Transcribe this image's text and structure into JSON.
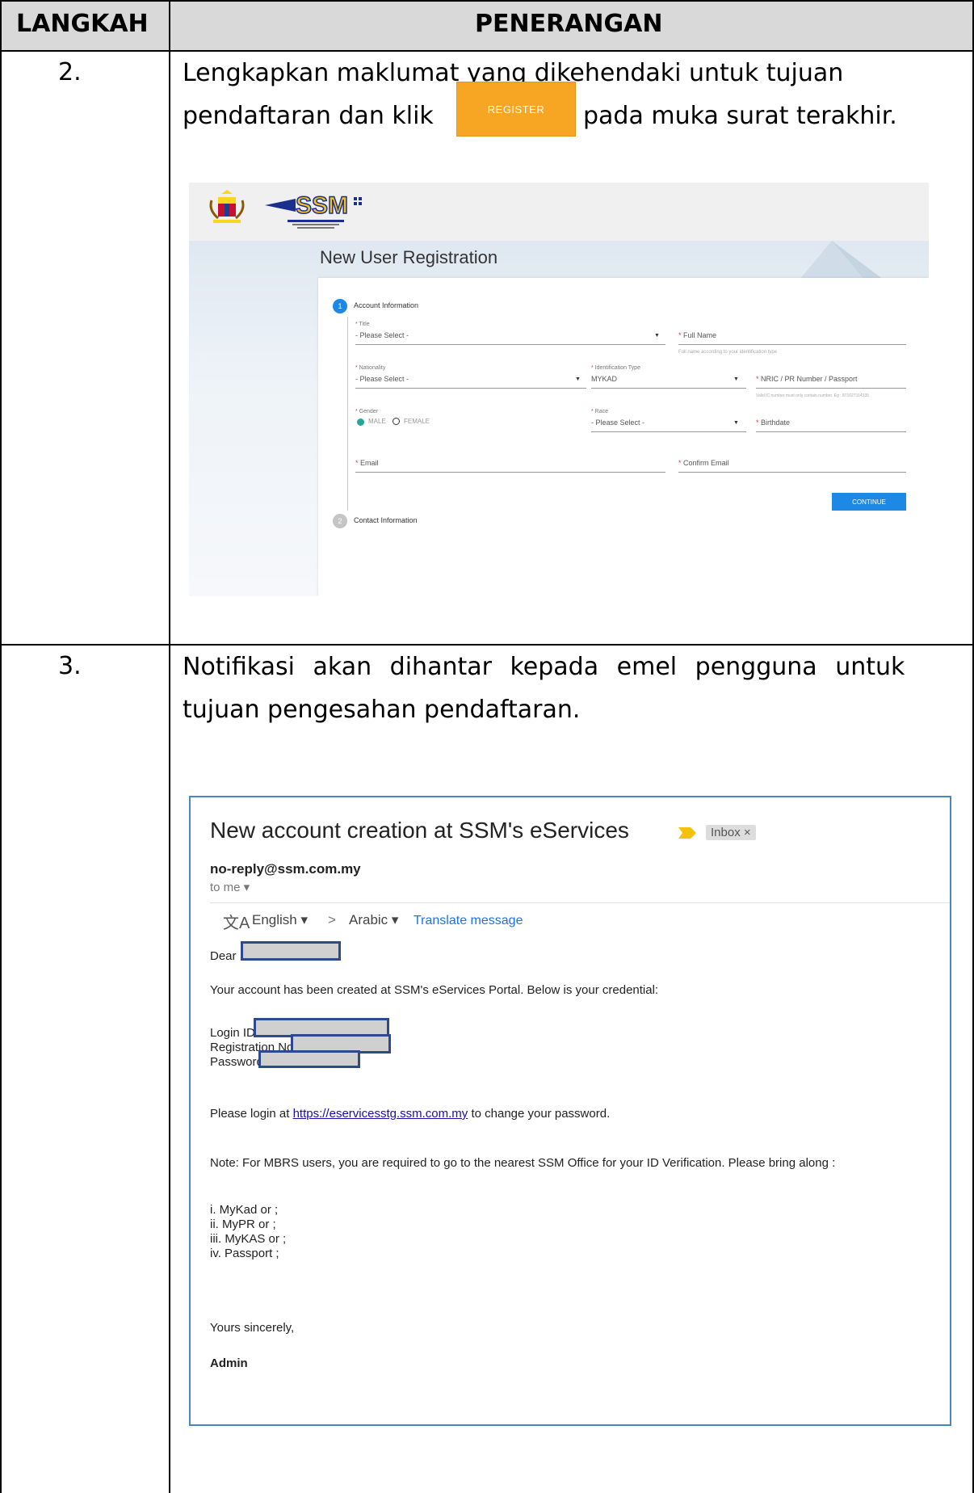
{
  "table": {
    "header_step": "LANGKAH",
    "header_desc": "PENERANGAN"
  },
  "rows": [
    {
      "step": "2.",
      "desc_line1": "Lengkapkan maklumat yang dikehendaki untuk tujuan",
      "desc_line2a": "pendaftaran dan klik",
      "button_label": "REGISTER",
      "desc_line2b": "pada muka surat terakhir."
    },
    {
      "step": "3.",
      "desc_line1": "Notifikasi akan dihantar kepada emel pengguna untuk",
      "desc_line2": "tujuan pengesahan pendaftaran."
    }
  ],
  "registration_form": {
    "title": "New User Registration",
    "step1_label": "Account Information",
    "step1_number": "1",
    "step2_label": "Contact Information",
    "step2_number": "2",
    "fields": {
      "title_label": "Title",
      "title_value": "- Please Select -",
      "fullname_label": "Full Name",
      "fullname_hint": "Full name according to your identification type",
      "nationality_label": "Nationality",
      "nationality_value": "- Please Select -",
      "idtype_label": "Identification Type",
      "idtype_value": "MYKAD",
      "nric_label": "NRIC / PR Number / Passport",
      "nric_hint": "Valid IC number must only contain number. Eg : 871027114335",
      "gender_label": "Gender",
      "gender_male": "MALE",
      "gender_female": "FEMALE",
      "race_label": "Race",
      "race_value": "- Please Select -",
      "birthdate_label": "Birthdate",
      "email_label": "Email",
      "confirm_email_label": "Confirm Email"
    },
    "continue_label": "CONTINUE"
  },
  "email": {
    "subject": "New account creation at SSM's eServices",
    "inbox_chip": "Inbox ×",
    "from": "no-reply@ssm.com.my",
    "to": "to me ▾",
    "translate_icon_glyph": "文A",
    "lang_from": "English ▾",
    "arrow": ">",
    "lang_to": "Arabic ▾",
    "translate_link": "Translate message",
    "dear": "Dear",
    "intro": "Your account has been created at SSM's eServices Portal. Below is your credential:",
    "login_id": "Login ID",
    "registration_no": "Registration No",
    "password": "Password",
    "login_prefix": "Please login at ",
    "login_link": "https://eservicesstg.ssm.com.my",
    "login_suffix": " to change your password.",
    "note": "Note: For MBRS users, you are required to go to the nearest SSM Office for your ID Verification. Please bring along :",
    "items": [
      "i. MyKad or ;",
      "ii. MyPR or ;",
      "iii. MyKAS or ;",
      "iv. Passport ;"
    ],
    "closing": "Yours sincerely,",
    "signature": "Admin"
  }
}
